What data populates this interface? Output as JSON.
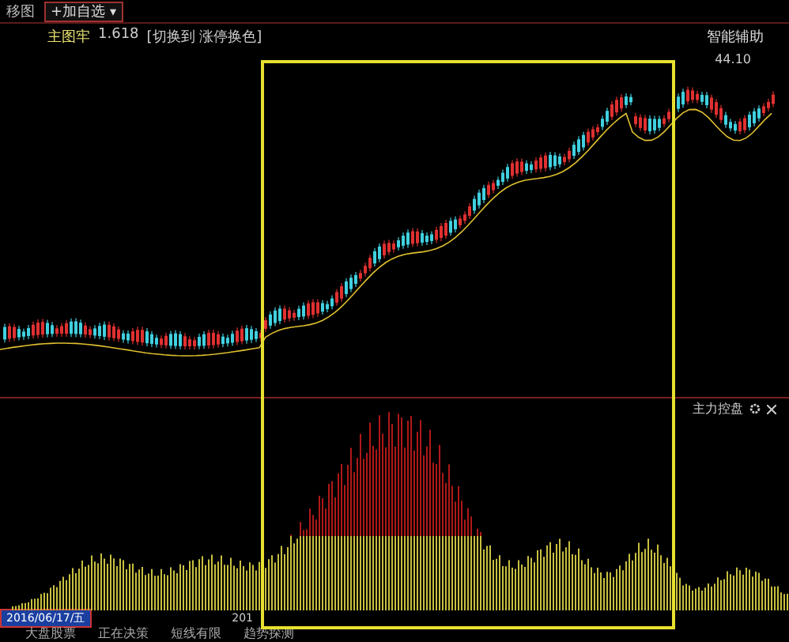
{
  "toolbar": {
    "menu_label": "移图",
    "add_button": "+加自选",
    "dropdown": "▾"
  },
  "main_chart": {
    "indicator_name": "主图牢",
    "indicator_value": "1.618",
    "hint": "[切换到 涨停换色]",
    "assist_title": "智能辅助",
    "price_marker": "44.10"
  },
  "indicator_panel": {
    "title": "主力控盘"
  },
  "footer": {
    "date": "2016/06/17/五",
    "year_partial": "201",
    "tabs": [
      {
        "label": "大盘股票",
        "selected": false
      },
      {
        "label": "正在决策",
        "selected": false
      },
      {
        "label": "短线有限",
        "selected": false
      },
      {
        "label": "趋势探测",
        "selected": false
      }
    ]
  }
}
